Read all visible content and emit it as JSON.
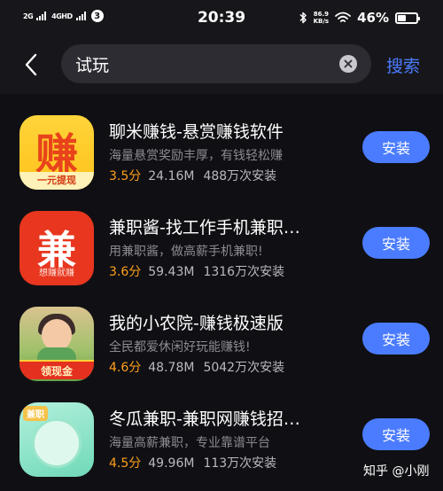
{
  "status_bar": {
    "sim1_label": "2G",
    "sim2_label": "4GHD",
    "sim_badge": "3",
    "time": "20:39",
    "net_speed_value": "86.9",
    "net_speed_unit": "KB/s",
    "battery_percent": "46%",
    "battery_level": 0.46
  },
  "search": {
    "query": "试玩",
    "search_label": "搜索"
  },
  "apps": [
    {
      "title": "聊米赚钱-悬赏赚钱软件",
      "description": "海量悬赏奖励丰厚，有钱轻松赚",
      "rating": "3.5分",
      "size": "24.16M",
      "installs": "488万次安装",
      "install_label": "安装",
      "icon_text": "赚",
      "icon_subtext": "一元提现"
    },
    {
      "title": "兼职酱-找工作手机兼职…",
      "description": "用兼职酱，做高薪手机兼职!",
      "rating": "3.6分",
      "size": "59.43M",
      "installs": "1316万次安装",
      "install_label": "安装",
      "icon_text": "兼",
      "icon_subtext": "想赚就赚"
    },
    {
      "title": "我的小农院-赚钱极速版",
      "description": "全民都爱休闲好玩能赚钱!",
      "rating": "4.6分",
      "size": "48.78M",
      "installs": "5042万次安装",
      "install_label": "安装",
      "icon_subtext": "领现金"
    },
    {
      "title": "冬瓜兼职-兼职网赚钱招…",
      "description": "海量高薪兼职，专业靠谱平台",
      "rating": "4.5分",
      "size": "49.96M",
      "installs": "113万次安装",
      "install_label": "安装",
      "icon_subtext": "兼职"
    }
  ],
  "watermark": "知乎 @小刚",
  "colors": {
    "accent": "#4b7cff",
    "rating": "#ff9f1a",
    "background": "#101014"
  }
}
